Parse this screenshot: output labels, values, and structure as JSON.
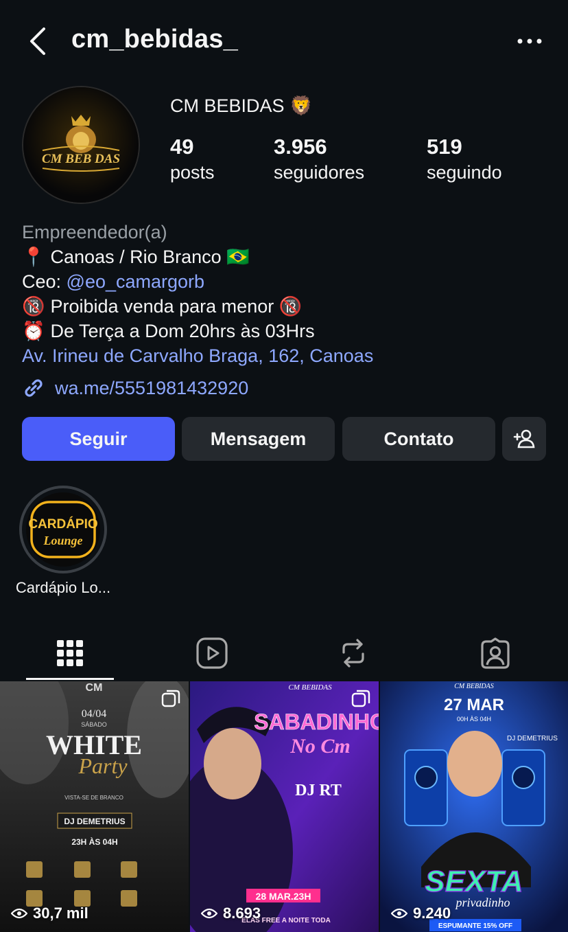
{
  "header": {
    "username": "cm_bebidas_",
    "back_icon": "chevron-left-icon",
    "more_icon": "more-horizontal-icon"
  },
  "profile": {
    "display_name": "CM BEBIDAS 🦁",
    "avatar_logo_text": "CM BEB DAS",
    "stats": [
      {
        "value": "49",
        "label": "posts"
      },
      {
        "value": "3.956",
        "label": "seguidores"
      },
      {
        "value": "519",
        "label": "seguindo"
      }
    ]
  },
  "bio": {
    "category": "Empreendedor(a)",
    "lines": [
      {
        "emoji": "📍",
        "text": "Canoas / Rio Branco 🇧🇷"
      },
      {
        "prefix": "Ceo: ",
        "mention": "@eo_camargorb"
      },
      {
        "emoji": "🔞",
        "text": "Proibida venda para menor 🔞"
      },
      {
        "emoji": "⏰",
        "text": "De Terça a Dom 20hrs às 03Hrs"
      }
    ],
    "address": "Av. Irineu de Carvalho Braga, 162, Canoas",
    "link": "wa.me/5551981432920",
    "link_icon": "link-icon"
  },
  "actions": {
    "follow": "Seguir",
    "message": "Mensagem",
    "contact": "Contato",
    "suggest_icon": "add-person-icon"
  },
  "highlights": [
    {
      "label": "Cardápio Lo...",
      "cover_text": [
        "CARDÁPIO",
        "Lounge"
      ]
    }
  ],
  "tabs": [
    {
      "name": "grid",
      "icon": "grid-icon",
      "active": true
    },
    {
      "name": "reels",
      "icon": "reels-icon",
      "active": false
    },
    {
      "name": "reposts",
      "icon": "repost-icon",
      "active": false
    },
    {
      "name": "tagged",
      "icon": "tagged-icon",
      "active": false
    }
  ],
  "posts": [
    {
      "views": "30,7 mil",
      "title": "WHITE",
      "subtitle": "Party",
      "date": "04/04",
      "day": "SÁBADO",
      "brand": "CM",
      "dj": "DJ DEMETRIUS",
      "hours": "23H ÀS 04H",
      "tagline": "VISTA-SE DE BRANCO"
    },
    {
      "views": "8.693",
      "title": "SABADINHO",
      "subtitle": "No Cm",
      "brand": "CM BEBIDAS",
      "dj": "DJ RT",
      "date": "28 MAR.23H",
      "footer": "ELAS FREE A NOITE TODA"
    },
    {
      "views": "9.240",
      "title": "SEXTA",
      "subtitle": "privadinho",
      "brand": "CM BEBIDAS",
      "date": "27 MAR",
      "hours": "00H ÀS 04H",
      "dj": "DJ DEMETRIUS",
      "footer": "ESPUMANTE 15% OFF"
    }
  ],
  "colors": {
    "background": "#0c1014",
    "primary_button": "#4a5df9",
    "secondary_button": "#25292e",
    "link": "#8ea8ff",
    "muted": "#9aa0a6"
  }
}
